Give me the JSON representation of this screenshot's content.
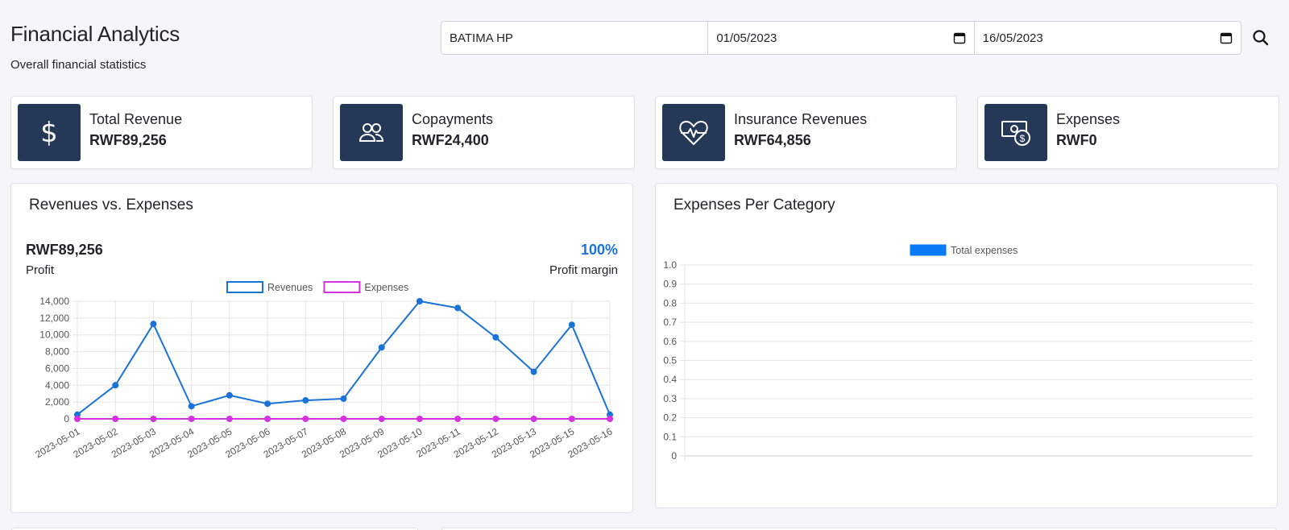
{
  "header": {
    "title": "Financial Analytics",
    "subtitle": "Overall financial statistics"
  },
  "filters": {
    "facility": "BATIMA HP",
    "start_date": "01/05/2023",
    "end_date": "16/05/2023",
    "search_icon": "search-icon",
    "calendar_icon": "calendar-icon"
  },
  "stats": [
    {
      "label": "Total Revenue",
      "value": "RWF89,256",
      "icon": "dollar-icon"
    },
    {
      "label": "Copayments",
      "value": "RWF24,400",
      "icon": "users-icon"
    },
    {
      "label": "Insurance Revenues",
      "value": "RWF64,856",
      "icon": "heart-pulse-icon"
    },
    {
      "label": "Expenses",
      "value": "RWF0",
      "icon": "cash-coin-icon"
    }
  ],
  "rev_panel": {
    "title": "Revenues vs. Expenses",
    "profit_value": "RWF89,256",
    "profit_label": "Profit",
    "margin_value": "100%",
    "margin_label": "Profit margin"
  },
  "exp_panel": {
    "title": "Expenses Per Category"
  },
  "colors": {
    "accent": "#1a73d9",
    "revenues": "#1a73d9",
    "expenses": "#d633e0",
    "icon_bg": "#253858",
    "total_expenses": "#0a7af5"
  },
  "chart_data": [
    {
      "type": "line",
      "categories": [
        "2023-05-01",
        "2023-05-02",
        "2023-05-03",
        "2023-05-04",
        "2023-05-05",
        "2023-05-06",
        "2023-05-07",
        "2023-05-08",
        "2023-05-09",
        "2023-05-10",
        "2023-05-11",
        "2023-05-12",
        "2023-05-13",
        "2023-05-15",
        "2023-05-16"
      ],
      "series": [
        {
          "name": "Revenues",
          "color": "#1a73d9",
          "values": [
            500,
            4000,
            11300,
            1500,
            2800,
            1800,
            2200,
            2400,
            8500,
            14000,
            13200,
            9700,
            5600,
            11200,
            500
          ]
        },
        {
          "name": "Expenses",
          "color": "#d633e0",
          "values": [
            0,
            0,
            0,
            0,
            0,
            0,
            0,
            0,
            0,
            0,
            0,
            0,
            0,
            0,
            0
          ]
        }
      ],
      "yticks": [
        "0",
        "2,000",
        "4,000",
        "6,000",
        "8,000",
        "10,000",
        "12,000",
        "14,000"
      ],
      "ylim": [
        0,
        14000
      ],
      "grid": true,
      "legend": "top-center"
    },
    {
      "type": "bar",
      "categories": [],
      "series": [
        {
          "name": "Total expenses",
          "color": "#0a7af5",
          "values": []
        }
      ],
      "yticks": [
        "0",
        "0.1",
        "0.2",
        "0.3",
        "0.4",
        "0.5",
        "0.6",
        "0.7",
        "0.8",
        "0.9",
        "1.0"
      ],
      "ylim": [
        0,
        1
      ],
      "grid": true,
      "legend": "top-center"
    }
  ]
}
